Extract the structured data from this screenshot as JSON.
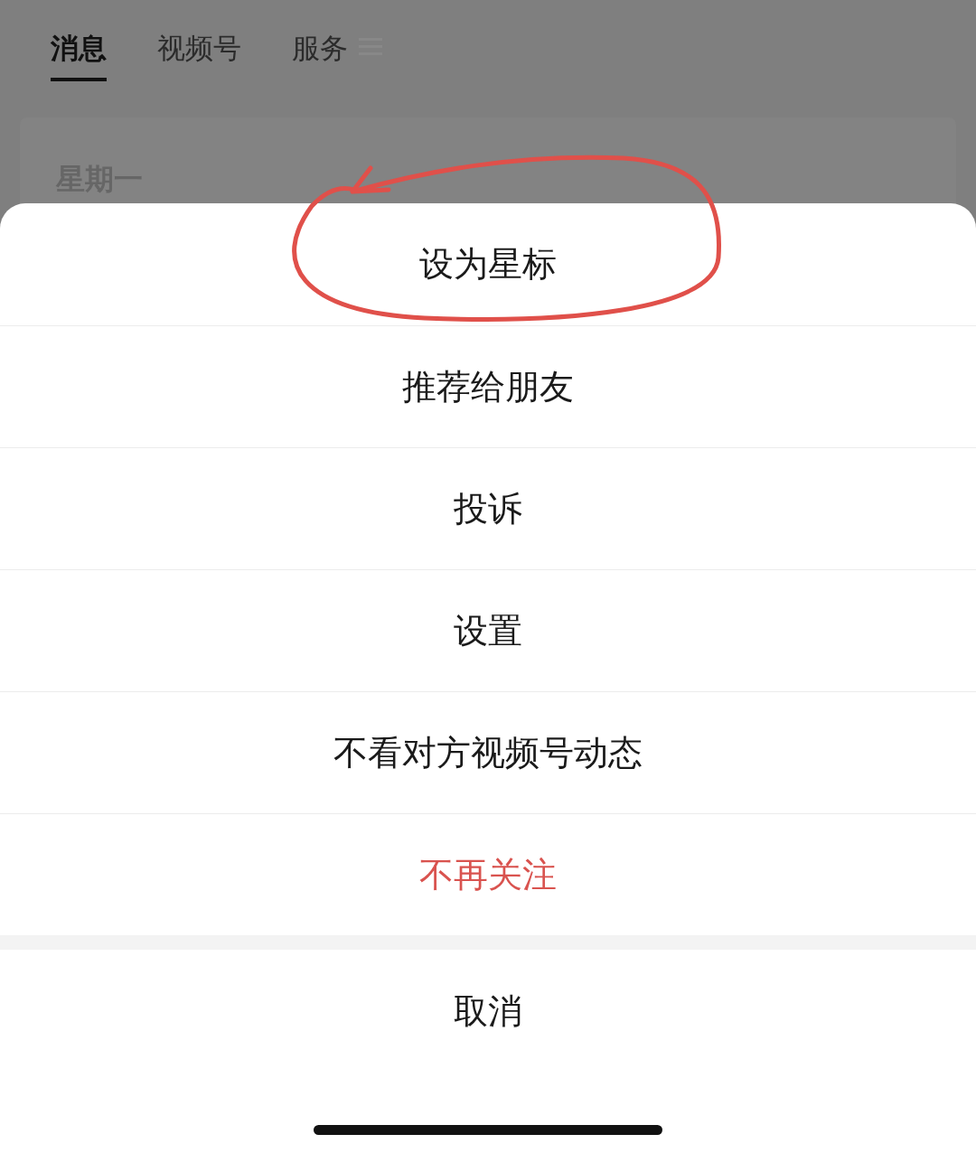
{
  "tabs": [
    {
      "label": "消息",
      "selected": true
    },
    {
      "label": "视频号",
      "selected": false
    },
    {
      "label": "服务",
      "selected": false
    }
  ],
  "card": {
    "date": "星期一"
  },
  "action_sheet": {
    "items": [
      {
        "label": "设为星标",
        "destructive": false
      },
      {
        "label": "推荐给朋友",
        "destructive": false
      },
      {
        "label": "投诉",
        "destructive": false
      },
      {
        "label": "设置",
        "destructive": false
      },
      {
        "label": "不看对方视频号动态",
        "destructive": false
      },
      {
        "label": "不再关注",
        "destructive": true
      }
    ],
    "cancel": "取消"
  }
}
